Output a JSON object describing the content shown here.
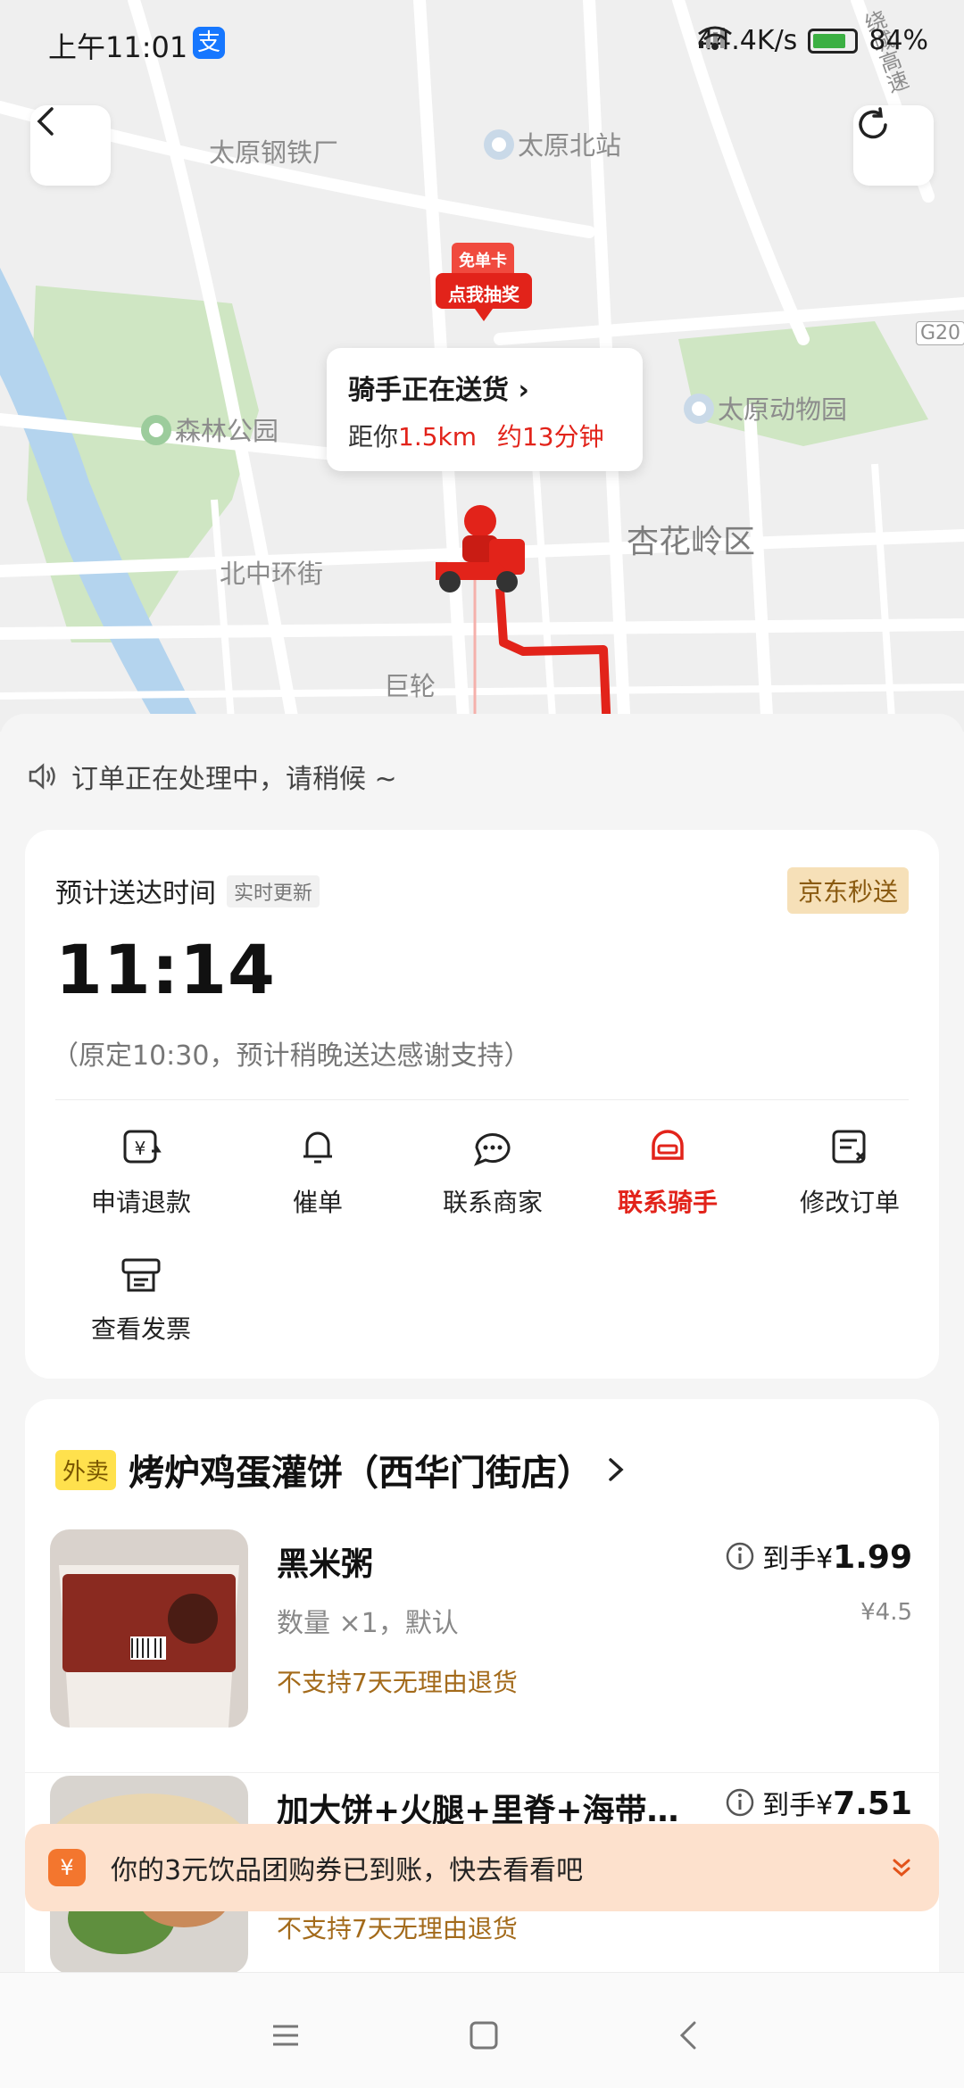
{
  "status_bar": {
    "time": "上午11:01",
    "pay_icon": "支",
    "net_speed": "44.4K/s",
    "battery": "84%"
  },
  "map": {
    "labels": {
      "taiyuan_steel": "太原钢铁厂",
      "taiyuan_north": "太原北站",
      "forest_park": "森林公园",
      "zoo": "太原动物园",
      "xinghualing": "杏花岭区",
      "beizhong": "北中环街",
      "julun": "巨轮",
      "g20": "G20",
      "ring_expressway": "绕城高速"
    },
    "coupon_pin": {
      "line1": "免单卡",
      "line2": "点我抽奖"
    },
    "bubble": {
      "title": "骑手正在送货",
      "distance_prefix": "距你",
      "distance": "1.5km",
      "eta": "约13分钟"
    }
  },
  "notice": "订单正在处理中，请稍候 ~",
  "delivery": {
    "estimate_label": "预计送达时间",
    "realtime_tag": "实时更新",
    "service_badge": "京东秒送",
    "time": "11:14",
    "note": "（原定10:30，预计稍晚送达感谢支持）",
    "actions": [
      {
        "label": "申请退款",
        "icon": "refund-icon"
      },
      {
        "label": "催单",
        "icon": "bell-icon"
      },
      {
        "label": "联系商家",
        "icon": "chat-icon"
      },
      {
        "label": "联系骑手",
        "icon": "helmet-icon"
      },
      {
        "label": "修改订单",
        "icon": "edit-order-icon"
      },
      {
        "label": "查看发票",
        "icon": "invoice-icon"
      }
    ]
  },
  "order": {
    "tag": "外卖",
    "shop": "烤炉鸡蛋灌饼（西华门街店）",
    "items": [
      {
        "name": "黑米粥",
        "qty": "数量 ×1，默认",
        "policy": "不支持7天无理由退货",
        "price_prefix": "到手¥",
        "price": "1.99",
        "original": "¥4.5"
      },
      {
        "name": "加大饼+火腿+里脊+海带…",
        "qty": "",
        "policy": "不支持7天无理由退货",
        "price_prefix": "到手¥",
        "price": "7.51",
        "original": ""
      }
    ]
  },
  "toast": {
    "icon": "¥",
    "text": "你的3元饮品团购券已到账，快去看看吧"
  }
}
